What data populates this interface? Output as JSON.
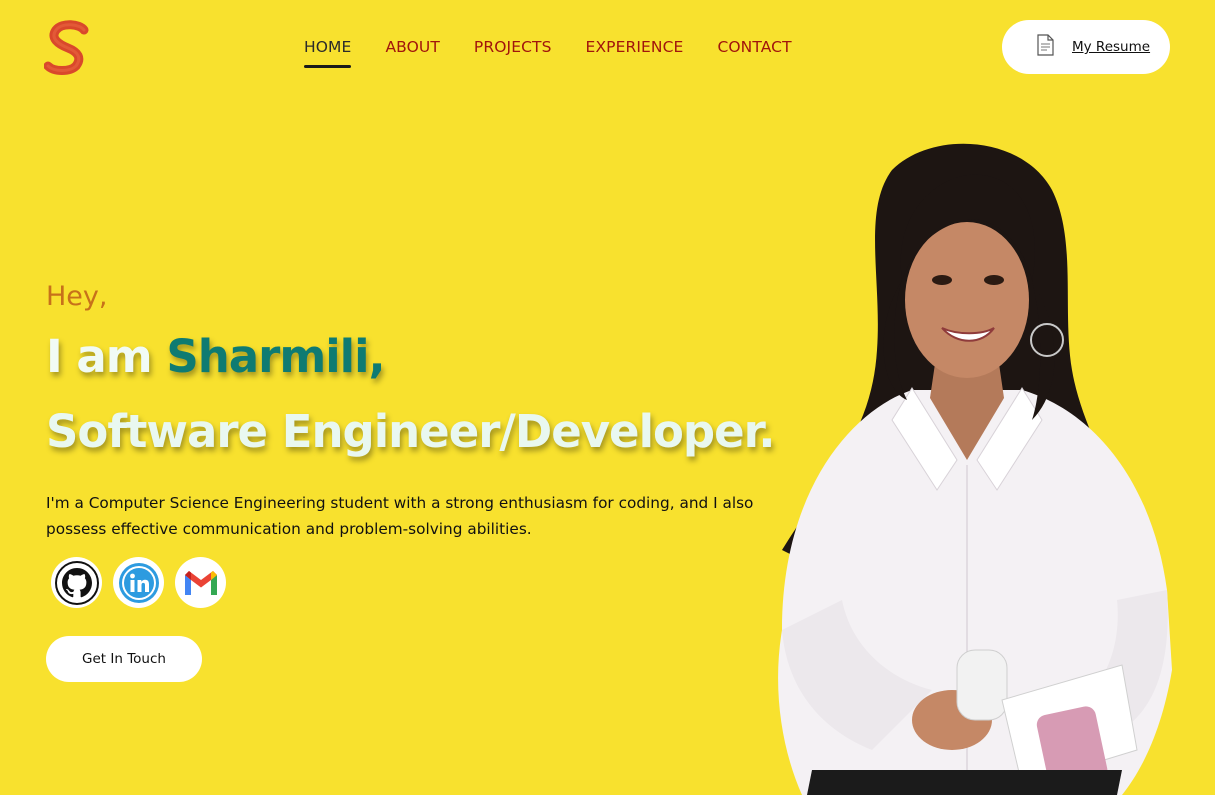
{
  "header": {
    "logo_letter": "S",
    "nav": [
      {
        "label": "HOME",
        "active": true
      },
      {
        "label": "ABOUT",
        "active": false
      },
      {
        "label": "PROJECTS",
        "active": false
      },
      {
        "label": "EXPERIENCE",
        "active": false
      },
      {
        "label": "CONTACT",
        "active": false
      }
    ],
    "resume": {
      "label": "My Resume",
      "icon": "document-icon"
    }
  },
  "hero": {
    "greeting": "Hey,",
    "intro_prefix": "I am ",
    "name": "Sharmili,",
    "role": "Software Engineer/Developer.",
    "description": "I'm a Computer Science Engineering student with a strong enthusiasm for coding, and I also possess effective communication and problem-solving abilities.",
    "socials": [
      {
        "name": "GitHub",
        "icon": "github-icon"
      },
      {
        "name": "LinkedIn",
        "icon": "linkedin-icon"
      },
      {
        "name": "Gmail",
        "icon": "gmail-icon"
      }
    ],
    "cta_label": "Get In Touch"
  },
  "colors": {
    "background": "#f8e12e",
    "nav_text": "#a1150c",
    "greeting": "#c7711a",
    "name_accent": "#0e7b72",
    "logo": "#d9482b"
  }
}
